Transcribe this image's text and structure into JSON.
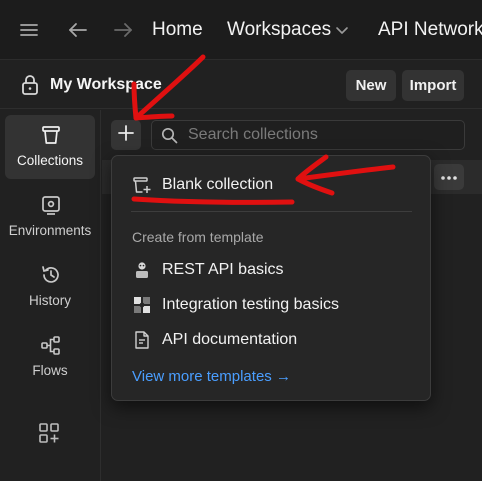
{
  "topbar": {
    "menu_icon": "hamburger-icon",
    "back_icon": "arrow-left-icon",
    "forward_icon": "arrow-right-icon",
    "home_label": "Home",
    "workspaces_label": "Workspaces",
    "api_network_label": "API Network"
  },
  "workspace": {
    "title": "My Workspace",
    "new_label": "New",
    "import_label": "Import"
  },
  "sidebar": {
    "items": [
      {
        "label": "Collections",
        "icon": "trash-can-icon",
        "active": true
      },
      {
        "label": "Environments",
        "icon": "environment-icon",
        "active": false
      },
      {
        "label": "History",
        "icon": "history-icon",
        "active": false
      },
      {
        "label": "Flows",
        "icon": "flows-icon",
        "active": false
      }
    ],
    "apps_icon": "add-apps-icon"
  },
  "search": {
    "placeholder": "Search collections"
  },
  "menu": {
    "blank_collection": "Blank collection",
    "template_heading": "Create from template",
    "templates": [
      {
        "label": "REST API basics",
        "icon": "rest-api-icon"
      },
      {
        "label": "Integration testing basics",
        "icon": "integration-testing-icon"
      },
      {
        "label": "API documentation",
        "icon": "document-icon"
      }
    ],
    "view_more": "View more templates →"
  },
  "colors": {
    "background": "#212121",
    "menu_background": "#262626",
    "link": "#4a9eff",
    "annotation": "#e01010"
  }
}
